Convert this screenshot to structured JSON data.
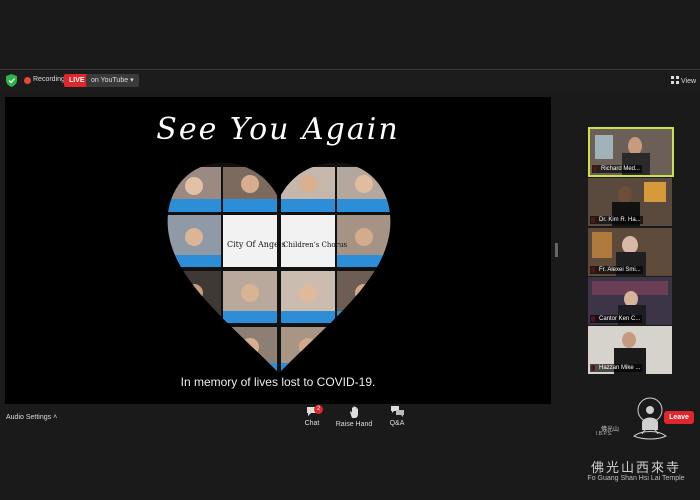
{
  "topbar": {
    "recording_label": "Recording",
    "live_label": "LIVE",
    "youtube_label": "on YouTube",
    "view_label": "View"
  },
  "share": {
    "title": "See You Again",
    "logo_left": "City Of Angels",
    "logo_right": "Children's Chorus",
    "caption": "In memory of lives lost to COVID-19."
  },
  "participants": [
    {
      "name": "Richard Med..."
    },
    {
      "name": "Dr. Kim R. Ha..."
    },
    {
      "name": "Fr. Alexei Smi..."
    },
    {
      "name": "Cantor Ken C..."
    },
    {
      "name": "Hazzan Mike ..."
    }
  ],
  "toolbar": {
    "audio_settings": "Audio Settings",
    "chat_label": "Chat",
    "chat_count": "2",
    "raise_hand_label": "Raise Hand",
    "qa_label": "Q&A",
    "leave_label": "Leave"
  },
  "watermark": {
    "small_cn": "佛光山",
    "ibps": "I.B.P.S.",
    "cn": "佛光山西來寺",
    "en": "Fo Guang Shan Hsi Lai Temple"
  }
}
